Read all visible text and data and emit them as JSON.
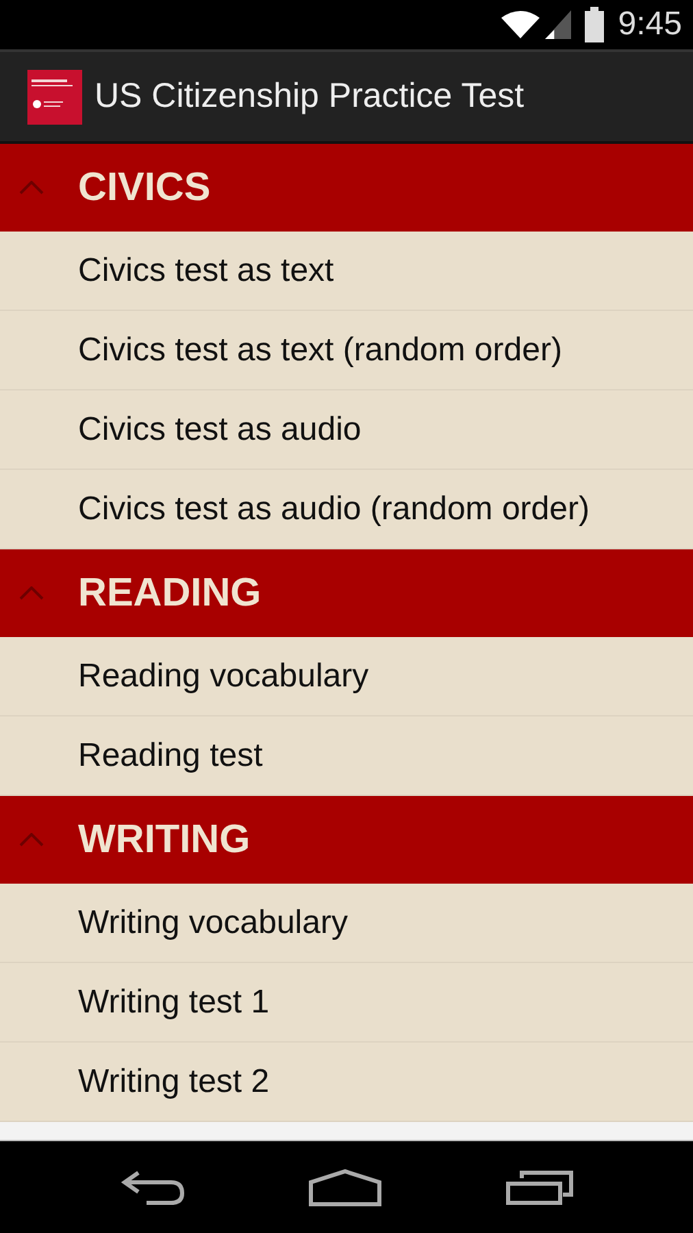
{
  "status_bar": {
    "time": "9:45"
  },
  "action_bar": {
    "title": "US Citizenship Practice Test"
  },
  "sections": [
    {
      "title": "CIVICS",
      "expanded": true,
      "items": [
        "Civics test as text",
        "Civics test as text (random order)",
        "Civics test as audio",
        "Civics test as audio (random order)"
      ]
    },
    {
      "title": "READING",
      "expanded": true,
      "items": [
        "Reading vocabulary",
        "Reading test"
      ]
    },
    {
      "title": "WRITING",
      "expanded": true,
      "items": [
        "Writing vocabulary",
        "Writing test 1",
        "Writing test 2"
      ]
    }
  ]
}
